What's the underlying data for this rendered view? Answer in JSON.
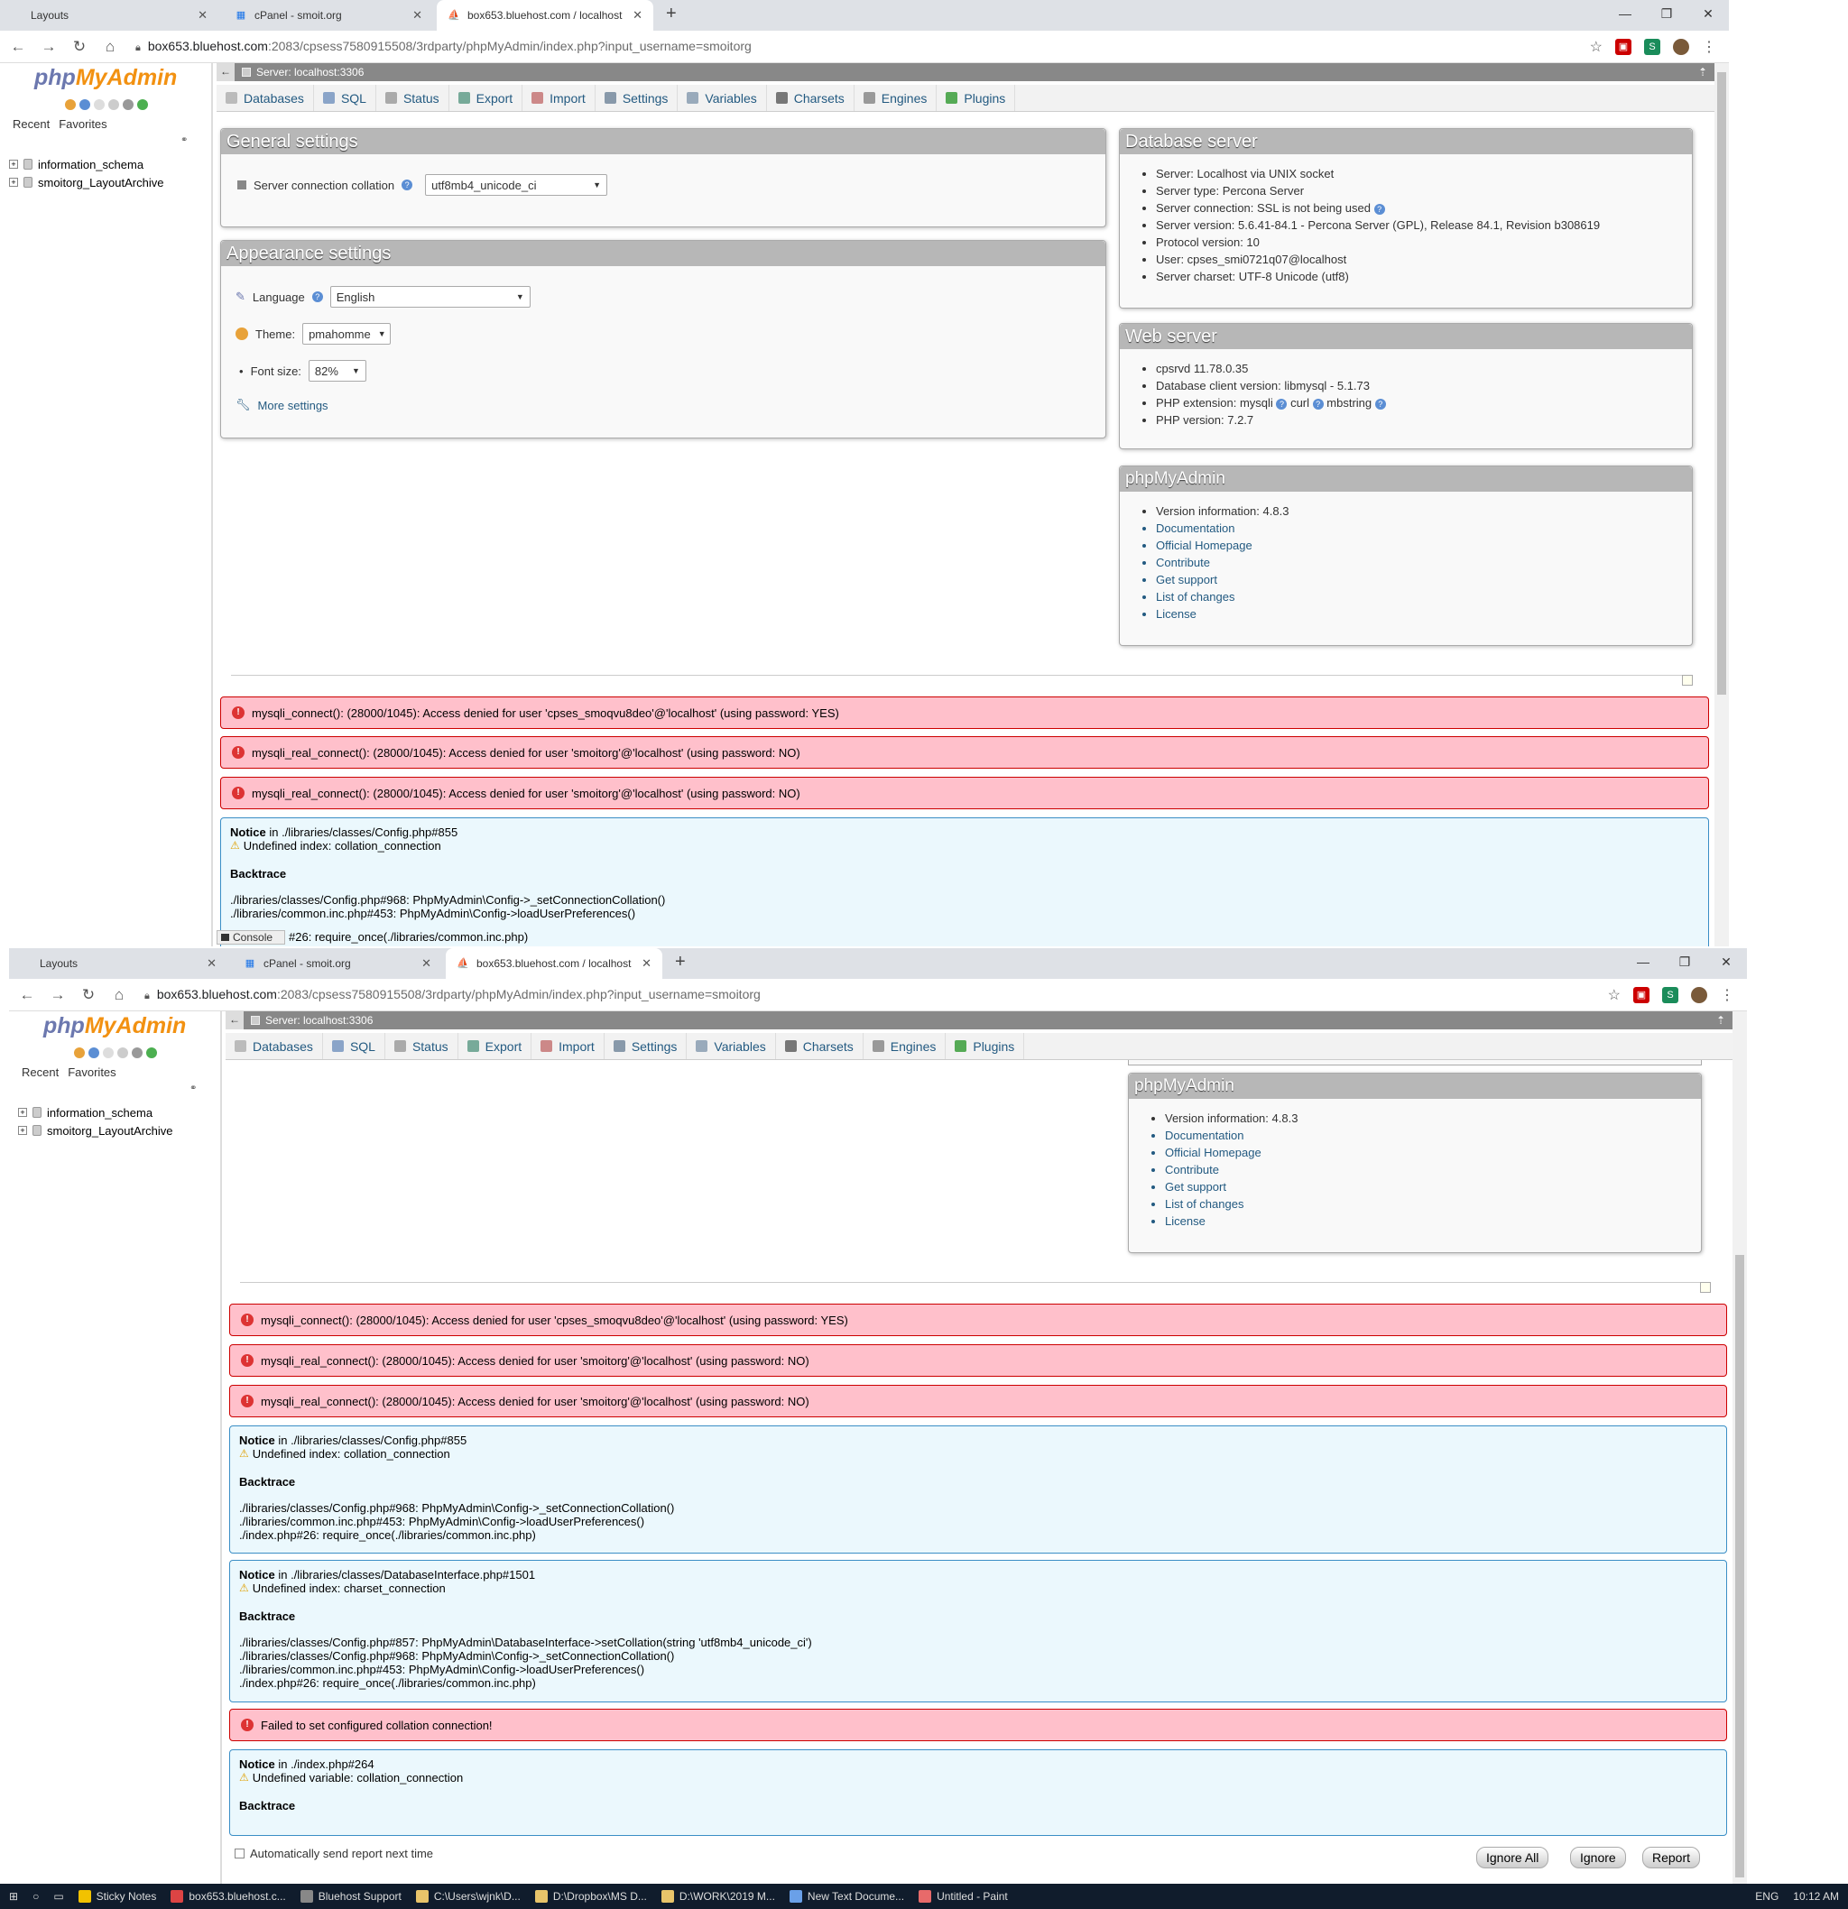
{
  "browser": {
    "tabs": [
      {
        "label": "Layouts"
      },
      {
        "label": "cPanel - smoit.org"
      },
      {
        "label": "box653.bluehost.com / localhost"
      }
    ],
    "url_host": "box653.bluehost.com",
    "url_path": ":2083/cpsess7580915508/3rdparty/phpMyAdmin/index.php?input_username=smoitorg"
  },
  "pma": {
    "logo_php": "php",
    "logo_myadmin": "MyAdmin",
    "recent": "Recent",
    "favorites": "Favorites",
    "databases": [
      "information_schema",
      "smoitorg_LayoutArchive"
    ],
    "server_label": "Server: localhost:3306",
    "menu": [
      "Databases",
      "SQL",
      "Status",
      "Export",
      "Import",
      "Settings",
      "Variables",
      "Charsets",
      "Engines",
      "Plugins"
    ],
    "general_settings": {
      "title": "General settings",
      "collation_label": "Server connection collation",
      "collation_value": "utf8mb4_unicode_ci"
    },
    "appearance": {
      "title": "Appearance settings",
      "language_label": "Language",
      "language_value": "English",
      "theme_label": "Theme:",
      "theme_value": "pmahomme",
      "fontsize_label": "Font size:",
      "fontsize_value": "82%",
      "more": "More settings"
    },
    "db_server": {
      "title": "Database server",
      "items": [
        "Server: Localhost via UNIX socket",
        "Server type: Percona Server",
        "Server connection: SSL is not being used",
        "Server version: 5.6.41-84.1 - Percona Server (GPL), Release 84.1, Revision b308619",
        "Protocol version: 10",
        "User: cpses_smi0721q07@localhost",
        "Server charset: UTF-8 Unicode (utf8)"
      ]
    },
    "web_server": {
      "title": "Web server",
      "items": [
        "cpsrvd 11.78.0.35",
        "Database client version: libmysql - 5.1.73",
        "PHP version: 7.2.7"
      ],
      "ext_label": "PHP extension: mysqli",
      "ext_curl": "curl",
      "ext_mb": "mbstring"
    },
    "pma_info": {
      "title": "phpMyAdmin",
      "version": "Version information: 4.8.3",
      "links": [
        "Documentation",
        "Official Homepage",
        "Contribute",
        "Get support",
        "List of changes",
        "License"
      ]
    },
    "errors": [
      "mysqli_connect(): (28000/1045): Access denied for user 'cpses_smoqvu8deo'@'localhost' (using password: YES)",
      "mysqli_real_connect(): (28000/1045): Access denied for user 'smoitorg'@'localhost' (using password: NO)",
      "mysqli_real_connect(): (28000/1045): Access denied for user 'smoitorg'@'localhost' (using password: NO)"
    ],
    "notice_word": "Notice",
    "in_word": " in ",
    "backtrace": "Backtrace",
    "notice1": {
      "file": "./libraries/classes/Config.php#855",
      "msg": "Undefined index: collation_connection",
      "trace": [
        "./libraries/classes/Config.php#968: PhpMyAdmin\\Config->_setConnectionCollation()",
        "./libraries/common.inc.php#453: PhpMyAdmin\\Config->loadUserPreferences()",
        "./index.php#26: require_once(./libraries/common.inc.php)"
      ]
    },
    "notice2": {
      "file": "./libraries/classes/DatabaseInterface.php#1501",
      "msg": "Undefined index: charset_connection",
      "trace": [
        "./libraries/classes/Config.php#857: PhpMyAdmin\\DatabaseInterface->setCollation(string 'utf8mb4_unicode_ci')",
        "./libraries/classes/Config.php#968: PhpMyAdmin\\Config->_setConnectionCollation()",
        "./libraries/common.inc.php#453: PhpMyAdmin\\Config->loadUserPreferences()",
        "./index.php#26: require_once(./libraries/common.inc.php)"
      ]
    },
    "failed": "Failed to set configured collation connection!",
    "notice3": {
      "file": "./index.php#264",
      "msg": "Undefined variable: collation_connection"
    },
    "auto_send": "Automatically send report next time",
    "btn_ignore_all": "Ignore All",
    "btn_ignore": "Ignore",
    "btn_report": "Report",
    "console": "Console",
    "console_overlap": "#26: require_once(./libraries/common.inc.php)"
  },
  "taskbar": {
    "items": [
      "Sticky Notes",
      "box653.bluehost.c...",
      "Bluehost Support",
      "C:\\Users\\wjnk\\D...",
      "D:\\Dropbox\\MS D...",
      "D:\\WORK\\2019 M...",
      "New Text Docume...",
      "Untitled - Paint"
    ],
    "lang": "ENG",
    "time": "10:12 AM"
  },
  "colors": {
    "php": "#6c78af",
    "myadmin": "#f29111",
    "link": "#235a81",
    "error_bg": "#ffc0cb",
    "notice_bg": "#ebf8fd"
  }
}
